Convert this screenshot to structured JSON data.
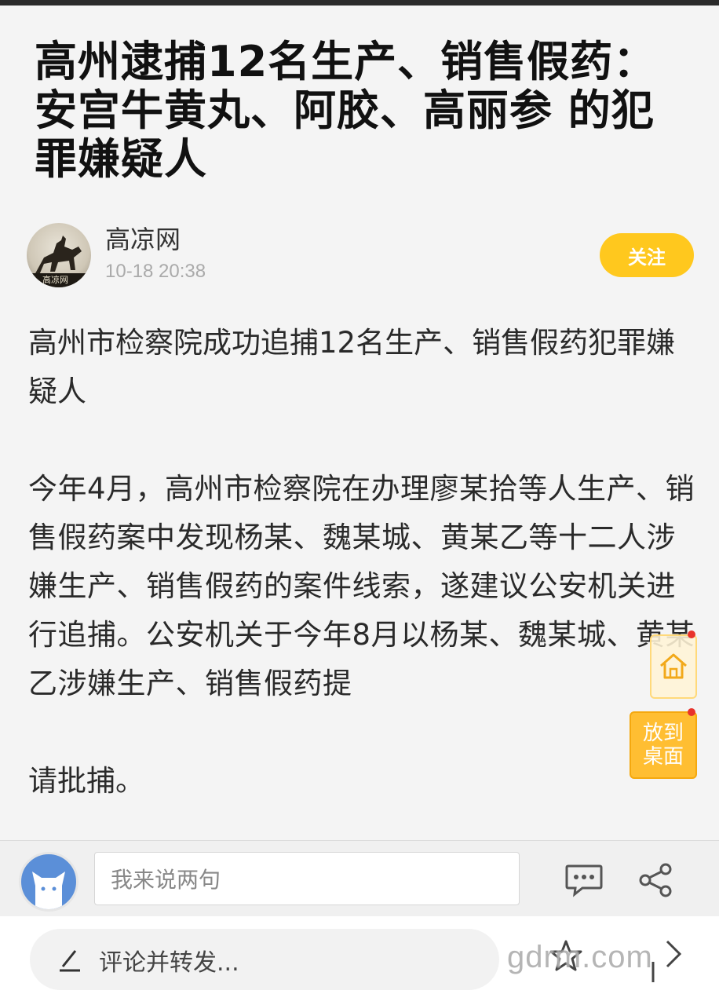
{
  "article": {
    "title": "高州逮捕12名生产、销售假药：安宫牛黄丸、阿胶、高丽参 的犯罪嫌疑人",
    "paragraphs": [
      "高州市检察院成功追捕12名生产、销售假药犯罪嫌疑人",
      "今年4月，高州市检察院在办理廖某拾等人生产、销售假药案中发现杨某、魏某城、黄某乙等十二人涉嫌生产、销售假药的案件线索，遂建议公安机关进行追捕。公安机关于今年8月以杨某、魏某城、黄某乙涉嫌生产、销售假药提",
      "请批捕。"
    ]
  },
  "author": {
    "name": "高凉网",
    "time": "10-18 20:38",
    "avatar_text": "高凉网",
    "follow_label": "关注"
  },
  "floating": {
    "desk_label": "放到桌面",
    "home_icon": "home-icon"
  },
  "comment_bar": {
    "placeholder": "我来说两句",
    "icons": [
      "comment-icon",
      "share-icon"
    ]
  },
  "bottom_bar": {
    "repost_label": "评论并转发...",
    "watermark": "gdrm.com",
    "icons": [
      "pen-icon",
      "star-icon",
      "next-icon"
    ]
  },
  "colors": {
    "accent": "#ffc81e",
    "desk_button": "#ffbe32",
    "badge": "#e8322b",
    "user_avatar": "#5b8fd8"
  }
}
